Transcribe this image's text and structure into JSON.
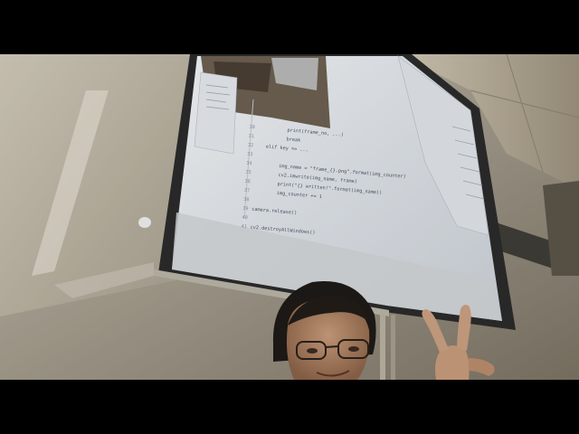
{
  "scene": {
    "description_tags": [
      "classroom",
      "projector-screen",
      "code-editor",
      "selfie",
      "peace-sign"
    ]
  },
  "projected_code": {
    "lines": [
      {
        "num": "30",
        "text": "print(frame_no, ...)"
      },
      {
        "num": "31",
        "text": "break"
      },
      {
        "num": "32",
        "text": "elif key == ..."
      },
      {
        "num": "33",
        "text": ""
      },
      {
        "num": "34",
        "text": "img_name = \"frame_{}.png\".format(img_counter)"
      },
      {
        "num": "35",
        "text": "cv2.imwrite(img_name, frame)"
      },
      {
        "num": "36",
        "text": "print(\"{} written!\".format(img_name))"
      },
      {
        "num": "37",
        "text": "img_counter += 1"
      },
      {
        "num": "38",
        "text": ""
      },
      {
        "num": "39",
        "text": "camera.release()"
      },
      {
        "num": "40",
        "text": ""
      },
      {
        "num": "41",
        "text": "cv2.destroyAllWindows()"
      }
    ]
  },
  "colors": {
    "wall": "#8f887a",
    "whiteboard": "#d9d4c6",
    "screen": "#e8ecef",
    "ceiling": "#a49e8d"
  }
}
